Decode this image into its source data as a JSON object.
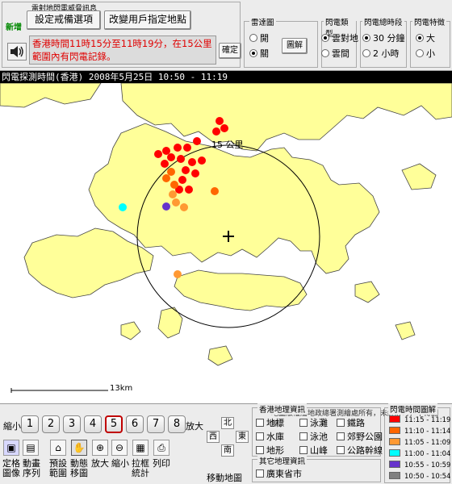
{
  "alert": {
    "section_title": "雷射地閃電威脅訊息",
    "new_tag": "新增",
    "settings_button": "設定戒備選項",
    "change_location_button": "改變用戶指定地點",
    "message": "香港時間11時15分至11時19分，在15公里範圍內有閃電記錄。",
    "confirm_button": "確定"
  },
  "radar": {
    "label": "雷達圖",
    "options": [
      "開",
      "關"
    ],
    "selected": 1,
    "legend_button": "圖解"
  },
  "lightning_type": {
    "label": "閃電類型",
    "options": [
      "雲對地",
      "雲間"
    ],
    "selected": 0
  },
  "time_span": {
    "label": "閃電總時段",
    "options": [
      "30 分鐘",
      "2 小時"
    ],
    "selected": 0
  },
  "feature": {
    "label": "閃電特徵",
    "options": [
      "大",
      "小"
    ],
    "selected": 0
  },
  "map": {
    "header": "閃電探測時間(香港) 2008年5月25日 10:50 - 11:19",
    "circle_label": "15 公里",
    "scale_label": "13km",
    "strike_colors": {
      "11:15-11:19": "#ff0000",
      "11:10-11:14": "#ff6600",
      "11:05-11:09": "#ff9933",
      "11:00-11:04": "#00ffff",
      "10:55-10:59": "#6633cc",
      "10:50-10:54": "#808080"
    }
  },
  "bottom": {
    "copyright": "地圖版權屬地政總署測繪處所有，未經許可，不得翻印。",
    "zoom_out_label": "縮小",
    "zoom_in_label": "放大",
    "zoom_levels": [
      "1",
      "2",
      "3",
      "4",
      "5",
      "6",
      "7",
      "8"
    ],
    "zoom_selected": "5",
    "tools": [
      {
        "icon": "locate-map-icon",
        "label": "定格圖像"
      },
      {
        "icon": "animation-icon",
        "label": "動畫序列"
      },
      {
        "icon": "home-icon",
        "label": "預設範圍"
      },
      {
        "icon": "hand-icon",
        "label": "動態移圖"
      },
      {
        "icon": "zoom-in-icon",
        "label": "放大"
      },
      {
        "icon": "zoom-out-icon",
        "label": "縮小"
      },
      {
        "icon": "stats-icon",
        "label": "拉框統計"
      },
      {
        "icon": "print-icon",
        "label": "列印"
      }
    ],
    "pan": {
      "north": "北",
      "south": "南",
      "east": "東",
      "west": "西",
      "label": "移動地圖"
    },
    "geo": {
      "label": "香港地理資訊",
      "items": [
        "地標",
        "泳灘",
        "鐵路",
        "水庫",
        "泳池",
        "郊野公園",
        "地形",
        "山峰",
        "公路幹線"
      ]
    },
    "other_geo": {
      "label": "其它地理資訊",
      "items": [
        "廣東省市"
      ]
    },
    "legend": {
      "label": "閃電時間圖解",
      "rows": [
        {
          "range": "11:15 - 11:19",
          "color": "#ff0000"
        },
        {
          "range": "11:10 - 11:14",
          "color": "#ff6600"
        },
        {
          "range": "11:05 - 11:09",
          "color": "#ff9933"
        },
        {
          "range": "11:00 - 11:04",
          "color": "#00ffff"
        },
        {
          "range": "10:55 - 10:59",
          "color": "#6633cc"
        },
        {
          "range": "10:50 - 10:54",
          "color": "#808080"
        }
      ]
    }
  }
}
